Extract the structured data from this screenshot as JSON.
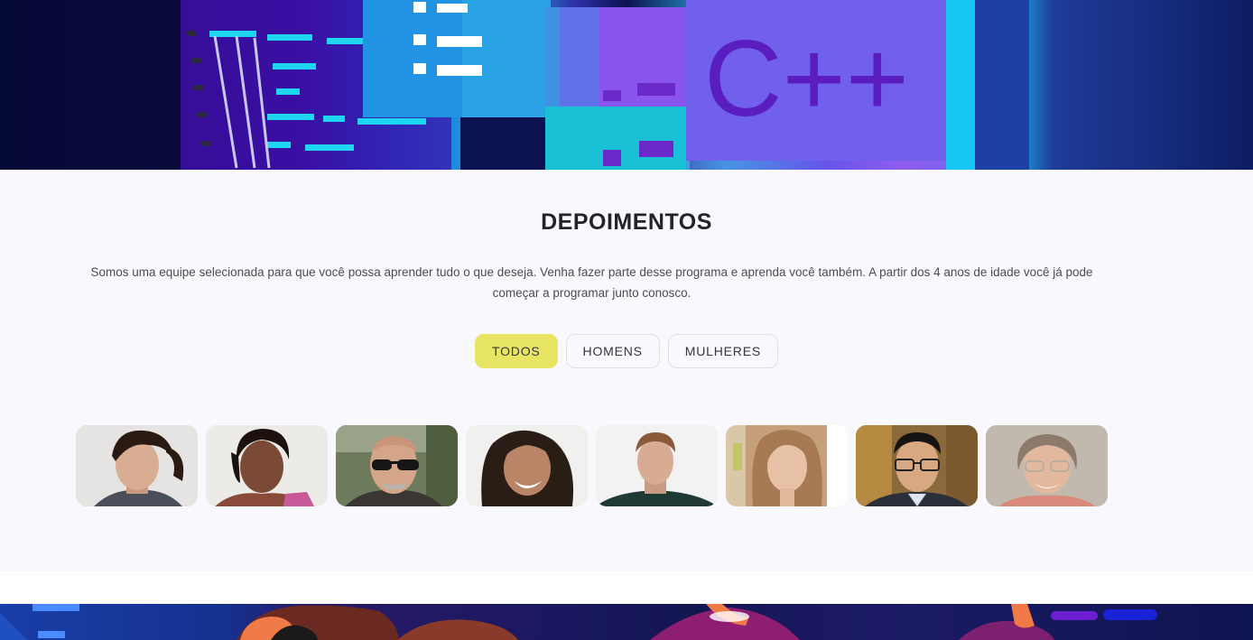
{
  "hero": {
    "code_label": "C++",
    "image_name": "programming-banner"
  },
  "testimonials": {
    "title": "DEPOIMENTOS",
    "description": "Somos uma equipe selecionada para que você possa aprender tudo o que deseja. Venha fazer parte desse programa e aprenda você também. A partir dos 4 anos de idade você já pode começar a programar junto conosco.",
    "filters": [
      {
        "label": "TODOS",
        "active": true
      },
      {
        "label": "HOMENS",
        "active": false
      },
      {
        "label": "MULHERES",
        "active": false
      }
    ],
    "avatars": [
      {
        "name": "avatar-man-dark-hair",
        "gender": "man"
      },
      {
        "name": "avatar-woman-dark-skin",
        "gender": "woman"
      },
      {
        "name": "avatar-man-sunglasses",
        "gender": "man"
      },
      {
        "name": "avatar-woman-smiling",
        "gender": "woman"
      },
      {
        "name": "avatar-man-young",
        "gender": "man"
      },
      {
        "name": "avatar-woman-long-hair",
        "gender": "woman"
      },
      {
        "name": "avatar-man-glasses",
        "gender": "man"
      },
      {
        "name": "avatar-woman-older-glasses",
        "gender": "woman"
      }
    ]
  },
  "colors": {
    "accent_active_filter": "#e8e565",
    "section_background": "#f8f8fd",
    "title_color": "#22242a"
  }
}
